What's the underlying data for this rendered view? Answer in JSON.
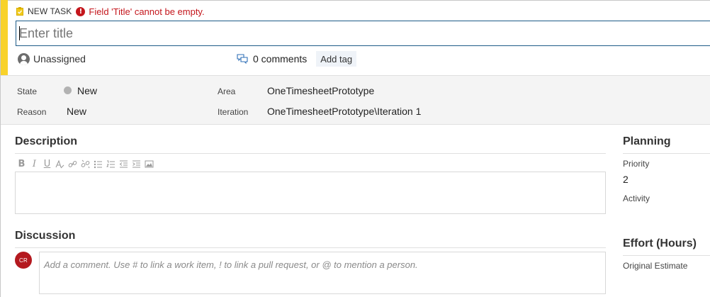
{
  "header": {
    "work_item_type": "NEW TASK",
    "error_message": "Field 'Title' cannot be empty.",
    "title_placeholder": "Enter title",
    "title_value": "",
    "assigned_to": "Unassigned",
    "comments_count": "0 comments",
    "add_tag_label": "Add tag",
    "accent_color": "#f8d22a",
    "error_color": "#c4161c"
  },
  "fields": {
    "state_label": "State",
    "state_value": "New",
    "reason_label": "Reason",
    "reason_value": "New",
    "area_label": "Area",
    "area_value": "OneTimesheetPrototype",
    "iteration_label": "Iteration",
    "iteration_value": "OneTimesheetPrototype\\Iteration 1"
  },
  "description": {
    "title": "Description",
    "toolbar": [
      "bold-icon",
      "italic-icon",
      "underline-icon",
      "highlight-icon",
      "link-icon",
      "unlink-icon",
      "bulleted-list-icon",
      "numbered-list-icon",
      "decrease-indent-icon",
      "increase-indent-icon",
      "image-icon"
    ],
    "toolbar_glyphs": {
      "bold": "B",
      "italic": "I",
      "underline": "U"
    }
  },
  "discussion": {
    "title": "Discussion",
    "avatar_initials": "CR",
    "avatar_color": "#b4191f",
    "comment_placeholder": "Add a comment. Use # to link a work item, ! to link a pull request, or @ to mention a person."
  },
  "planning": {
    "title": "Planning",
    "priority_label": "Priority",
    "priority_value": "2",
    "activity_label": "Activity"
  },
  "effort": {
    "title": "Effort (Hours)",
    "original_estimate_label": "Original Estimate"
  }
}
